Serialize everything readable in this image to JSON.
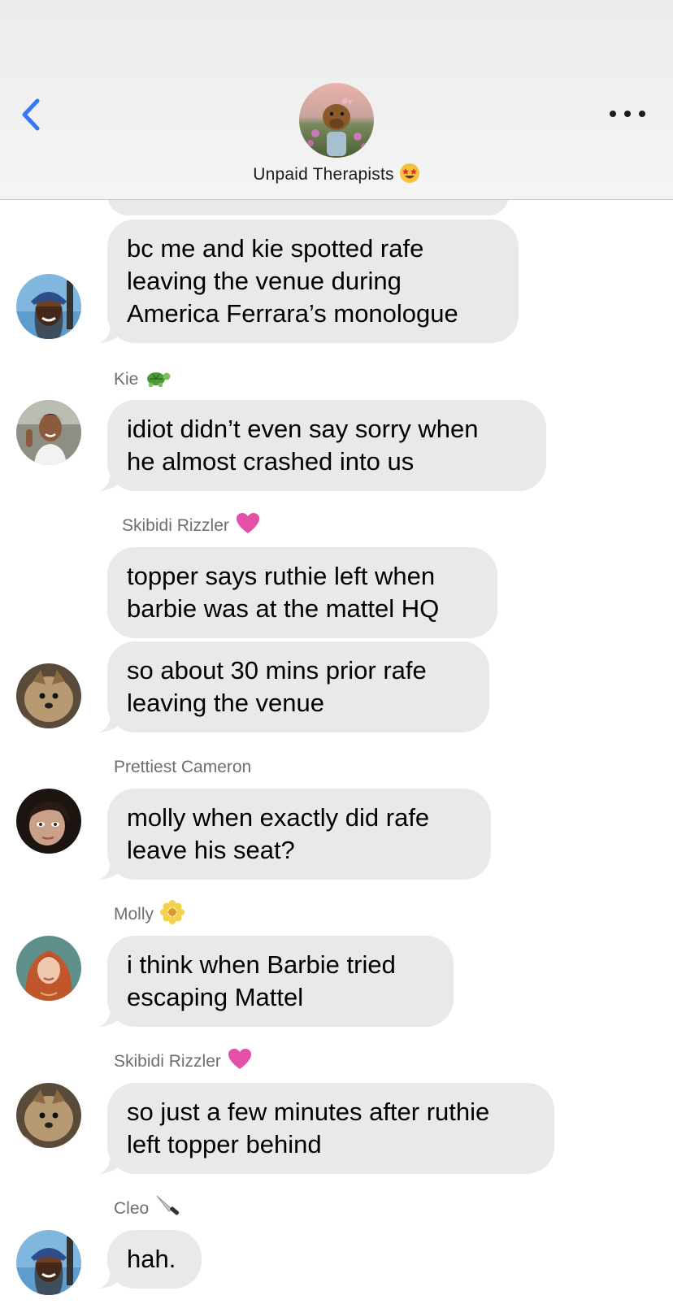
{
  "header": {
    "group_name": "Unpaid Therapists",
    "group_emoji": "star-struck-emoji"
  },
  "messages": [
    {
      "text": "bc me and kie spotted rafe\nleaving the venue during\nAmerica Ferrara’s monologue",
      "avatar": "cleo-avatar"
    },
    {
      "sender": "Kie",
      "sender_emoji": "turtle-emoji",
      "text": "idiot didn’t even say sorry when\nhe almost crashed into us",
      "avatar": "kie-avatar"
    },
    {
      "sender": "Skibidi Rizzler",
      "sender_emoji": "pink-heart-emoji",
      "text": "topper says ruthie left when\nbarbie was at the mattel HQ"
    },
    {
      "text": "so about 30 mins prior rafe\nleaving the venue",
      "avatar": "skibidi-avatar"
    },
    {
      "sender": "Prettiest Cameron",
      "text": "molly when exactly did rafe\nleave his seat?",
      "avatar": "cameron-avatar"
    },
    {
      "sender": "Molly",
      "sender_emoji": "blossom-emoji",
      "text": "i think when Barbie tried\nescaping Mattel",
      "avatar": "molly-avatar"
    },
    {
      "sender": "Skibidi Rizzler",
      "sender_emoji": "pink-heart-emoji",
      "text": "so just a few minutes after ruthie\nleft topper behind",
      "avatar": "skibidi-avatar"
    },
    {
      "sender": "Cleo",
      "sender_emoji": "knife-emoji",
      "text": "hah.",
      "avatar": "cleo-avatar"
    }
  ],
  "colors": {
    "bubble": "#e9e9eb",
    "accent": "#3478f6",
    "sender_text": "#6e6e73"
  }
}
